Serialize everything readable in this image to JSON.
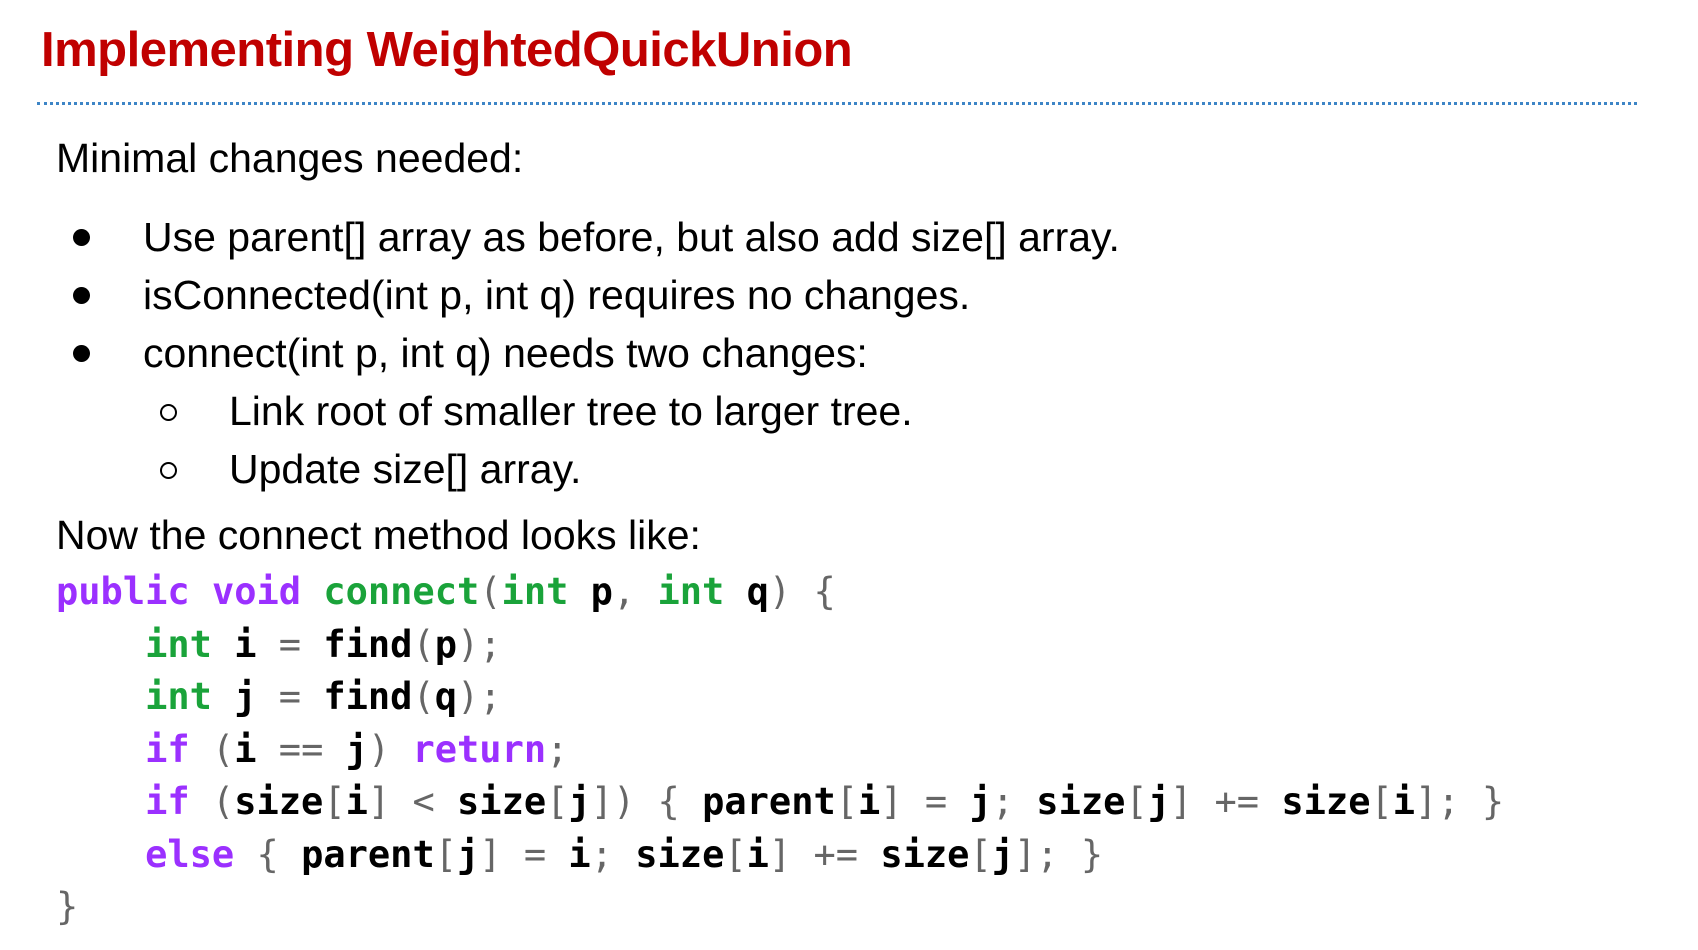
{
  "slide": {
    "title": "Implementing WeightedQuickUnion",
    "intro": "Minimal changes needed:",
    "bullets": [
      "Use parent[] array as before, but also add size[] array.",
      "isConnected(int p, int q) requires no changes.",
      "connect(int p, int q) needs two changes:"
    ],
    "sub_bullets": [
      "Link root of smaller tree to larger tree.",
      "Update size[] array."
    ],
    "outro": "Now the connect method looks like:"
  },
  "code": {
    "lines": [
      "public void connect(int p, int q) {",
      "    int i = find(p);",
      "    int j = find(q);",
      "    if (i == j) return;",
      "    if (size[i] < size[j]) { parent[i] = j; size[j] += size[i]; }",
      "    else { parent[j] = i; size[i] += size[j]; }",
      "}"
    ]
  },
  "colors": {
    "title": "#c00000",
    "divider": "#3d85c6",
    "keyword_purple": "#9b30ff",
    "keyword_green": "#1aa33a",
    "punctuation": "#666666"
  }
}
